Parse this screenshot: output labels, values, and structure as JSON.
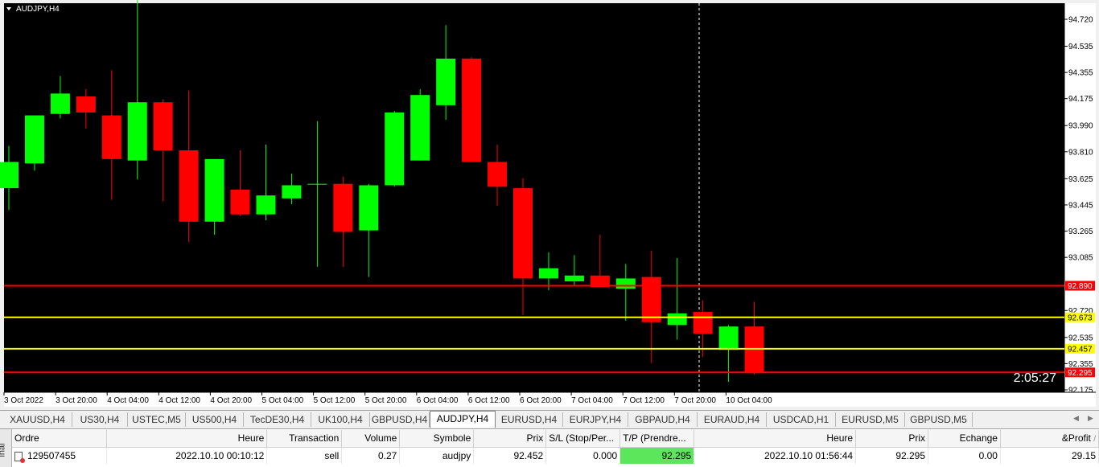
{
  "chart": {
    "title": "AUDJPY,H4",
    "countdown": "2:05:27",
    "bg_color": "#000000",
    "bull_color": "#00ff00",
    "bear_color": "#ff0000",
    "y_ticks": [
      "94.720",
      "94.535",
      "94.355",
      "94.175",
      "93.990",
      "93.810",
      "93.625",
      "93.445",
      "93.265",
      "93.085",
      "92.720",
      "92.535",
      "92.355",
      "92.175"
    ],
    "x_ticks": [
      "3 Oct 2022",
      "3 Oct 20:00",
      "4 Oct 04:00",
      "4 Oct 12:00",
      "4 Oct 20:00",
      "5 Oct 04:00",
      "5 Oct 12:00",
      "5 Oct 20:00",
      "6 Oct 04:00",
      "6 Oct 12:00",
      "6 Oct 20:00",
      "7 Oct 04:00",
      "7 Oct 12:00",
      "7 Oct 20:00",
      "10 Oct 04:00"
    ],
    "hlines": [
      {
        "label": "92.890",
        "value": 92.89,
        "color": "#ff0000"
      },
      {
        "label": "92.673",
        "value": 92.673,
        "color": "#ffff00"
      },
      {
        "label": "92.457",
        "value": 92.457,
        "color": "#ffff00"
      },
      {
        "label": "92.295",
        "value": 92.295,
        "color": "#ff0000"
      }
    ],
    "candles": [
      {
        "o": 93.56,
        "h": 93.85,
        "l": 93.41,
        "c": 93.74
      },
      {
        "o": 93.73,
        "h": 94.06,
        "l": 93.68,
        "c": 94.06
      },
      {
        "o": 94.07,
        "h": 94.33,
        "l": 94.04,
        "c": 94.21
      },
      {
        "o": 94.19,
        "h": 94.24,
        "l": 93.97,
        "c": 94.08
      },
      {
        "o": 94.06,
        "h": 94.37,
        "l": 93.48,
        "c": 93.76
      },
      {
        "o": 93.75,
        "h": 94.87,
        "l": 93.62,
        "c": 94.15
      },
      {
        "o": 94.15,
        "h": 94.17,
        "l": 93.47,
        "c": 93.82
      },
      {
        "o": 93.82,
        "h": 94.23,
        "l": 93.19,
        "c": 93.33
      },
      {
        "o": 93.33,
        "h": 93.76,
        "l": 93.24,
        "c": 93.76
      },
      {
        "o": 93.55,
        "h": 93.82,
        "l": 93.37,
        "c": 93.38
      },
      {
        "o": 93.38,
        "h": 93.86,
        "l": 93.34,
        "c": 93.51
      },
      {
        "o": 93.49,
        "h": 93.66,
        "l": 93.45,
        "c": 93.58
      },
      {
        "o": 93.59,
        "h": 94.02,
        "l": 93.02,
        "c": 93.59
      },
      {
        "o": 93.59,
        "h": 93.64,
        "l": 93.02,
        "c": 93.26
      },
      {
        "o": 93.27,
        "h": 93.59,
        "l": 92.95,
        "c": 93.58
      },
      {
        "o": 93.58,
        "h": 94.09,
        "l": 93.57,
        "c": 94.08
      },
      {
        "o": 93.75,
        "h": 94.24,
        "l": 93.75,
        "c": 94.2
      },
      {
        "o": 94.13,
        "h": 94.68,
        "l": 94.03,
        "c": 94.45
      },
      {
        "o": 94.45,
        "h": 94.46,
        "l": 93.75,
        "c": 93.74
      },
      {
        "o": 93.74,
        "h": 93.86,
        "l": 93.44,
        "c": 93.57
      },
      {
        "o": 93.56,
        "h": 93.63,
        "l": 92.69,
        "c": 92.94
      },
      {
        "o": 92.94,
        "h": 93.12,
        "l": 92.86,
        "c": 93.01
      },
      {
        "o": 92.92,
        "h": 93.1,
        "l": 92.89,
        "c": 92.96
      },
      {
        "o": 92.96,
        "h": 93.24,
        "l": 92.88,
        "c": 92.88
      },
      {
        "o": 92.87,
        "h": 93.04,
        "l": 92.65,
        "c": 92.94
      },
      {
        "o": 92.95,
        "h": 93.13,
        "l": 92.36,
        "c": 92.64
      },
      {
        "o": 92.62,
        "h": 93.08,
        "l": 92.52,
        "c": 92.7
      },
      {
        "o": 92.71,
        "h": 92.79,
        "l": 92.4,
        "c": 92.56
      },
      {
        "o": 92.45,
        "h": 92.62,
        "l": 92.23,
        "c": 92.61
      },
      {
        "o": 92.61,
        "h": 92.78,
        "l": 92.28,
        "c": 92.29
      }
    ]
  },
  "tabs": [
    {
      "label": "XAUUSD,H4",
      "active": false
    },
    {
      "label": "US30,H4",
      "active": false
    },
    {
      "label": "USTEC,M5",
      "active": false
    },
    {
      "label": "US500,H4",
      "active": false
    },
    {
      "label": "TecDE30,H4",
      "active": false
    },
    {
      "label": "UK100,H4",
      "active": false
    },
    {
      "label": "GBPUSD,H4",
      "active": false
    },
    {
      "label": "AUDJPY,H4",
      "active": true
    },
    {
      "label": "EURUSD,H4",
      "active": false
    },
    {
      "label": "EURJPY,H4",
      "active": false
    },
    {
      "label": "GBPAUD,H4",
      "active": false
    },
    {
      "label": "EURAUD,H4",
      "active": false
    },
    {
      "label": "USDCAD,H1",
      "active": false
    },
    {
      "label": "EURUSD,M5",
      "active": false
    },
    {
      "label": "GBPUSD,M5",
      "active": false
    }
  ],
  "terminal": {
    "side_label": "inal",
    "headers": {
      "ordre": "Ordre",
      "heure": "Heure",
      "transaction": "Transaction",
      "volume": "Volume",
      "symbole": "Symbole",
      "prix": "Prix",
      "sl": "S/L (Stop/Per...",
      "tp": "T/P (Prendre...",
      "heure2": "Heure",
      "prix2": "Prix",
      "echange": "Echange",
      "profit": "&Profit"
    },
    "row": {
      "ordre": "129507455",
      "heure": "2022.10.10 00:10:12",
      "transaction": "sell",
      "volume": "0.27",
      "symbole": "audjpy",
      "prix": "92.452",
      "sl": "0.000",
      "tp": "92.295",
      "heure2": "2022.10.10 01:56:44",
      "prix2": "92.295",
      "echange": "0.00",
      "profit": "29.15"
    }
  }
}
